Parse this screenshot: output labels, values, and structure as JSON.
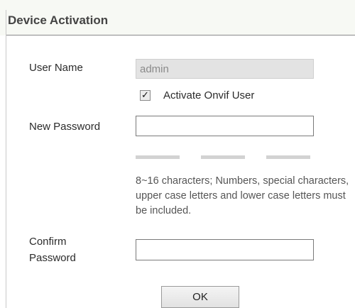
{
  "dialog": {
    "title": "Device Activation"
  },
  "form": {
    "user_name_label": "User Name",
    "user_name_value": "admin",
    "activate_onvif_label": "Activate Onvif User",
    "activate_onvif_checked": true,
    "new_password_label": "New Password",
    "new_password_value": "",
    "password_strength_filled": 0,
    "password_strength_segments": 3,
    "password_hint": "8~16 characters; Numbers, special characters, upper case letters and lower case letters must be included.",
    "confirm_password_label_line1": "Confirm",
    "confirm_password_label_line2": "Password",
    "confirm_password_value": ""
  },
  "actions": {
    "ok_label": "OK"
  },
  "colors": {
    "title_bar_bg": "#f7f9f4",
    "strength_bar_empty": "#d2d2d2",
    "disabled_input_bg": "#e3e3e3"
  }
}
